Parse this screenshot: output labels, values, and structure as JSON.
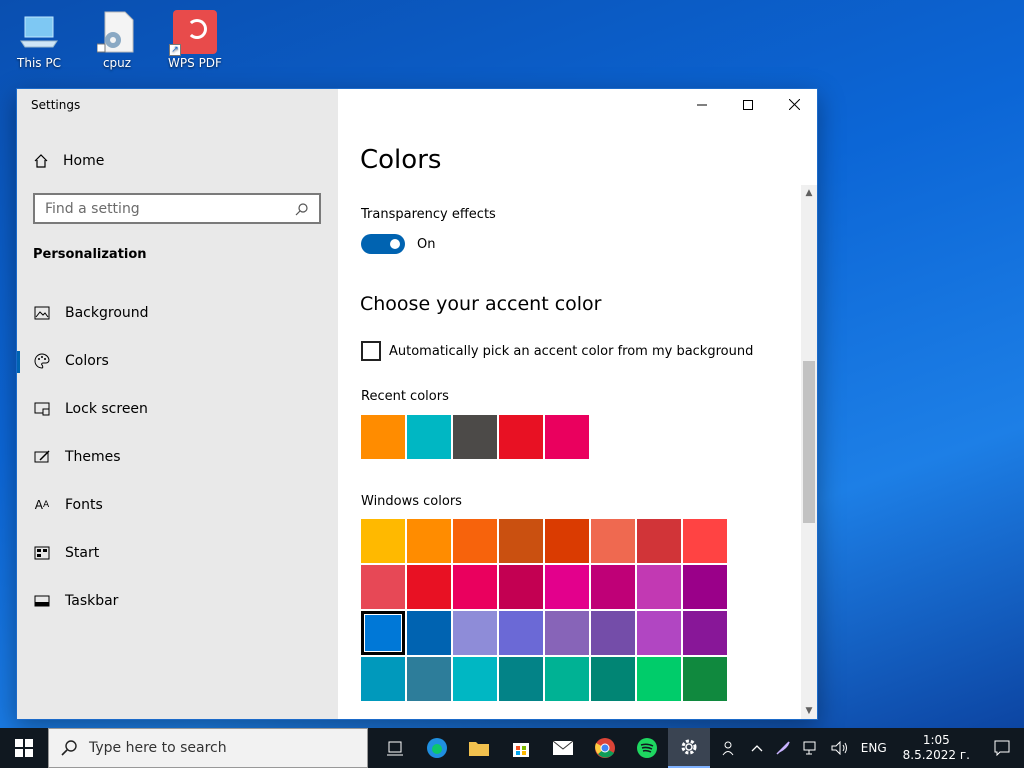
{
  "desktop": {
    "icons": [
      {
        "label": "This PC"
      },
      {
        "label": "cpuz"
      },
      {
        "label": "WPS PDF"
      }
    ]
  },
  "window": {
    "title": "Settings",
    "nav": {
      "home_label": "Home",
      "search_placeholder": "Find a setting",
      "section": "Personalization",
      "items": [
        {
          "label": "Background",
          "icon": "image-icon"
        },
        {
          "label": "Colors",
          "icon": "palette-icon"
        },
        {
          "label": "Lock screen",
          "icon": "lock-screen-icon"
        },
        {
          "label": "Themes",
          "icon": "themes-icon"
        },
        {
          "label": "Fonts",
          "icon": "fonts-icon"
        },
        {
          "label": "Start",
          "icon": "start-icon"
        },
        {
          "label": "Taskbar",
          "icon": "taskbar-icon"
        }
      ],
      "active_item": "Colors"
    },
    "main": {
      "title": "Colors",
      "transparency_label": "Transparency effects",
      "transparency_state": "On",
      "accent_heading": "Choose your accent color",
      "auto_pick_label": "Automatically pick an accent color from my background",
      "recent_label": "Recent colors",
      "recent_colors": [
        "#ff8c00",
        "#00b7c3",
        "#4c4a48",
        "#e81123",
        "#ea005e"
      ],
      "windows_label": "Windows colors",
      "windows_colors": [
        "#ffb900",
        "#ff8c00",
        "#f7630c",
        "#ca5010",
        "#da3b01",
        "#ef6950",
        "#d13438",
        "#ff4343",
        "#e74856",
        "#e81123",
        "#ea005e",
        "#c30052",
        "#e3008c",
        "#bf0077",
        "#c239b3",
        "#9a0089",
        "#0078d7",
        "#0063b1",
        "#8e8cd8",
        "#6b69d6",
        "#8764b8",
        "#744da9",
        "#b146c2",
        "#881798",
        "#0099bc",
        "#2d7d9a",
        "#00b7c3",
        "#038387",
        "#00b294",
        "#018574",
        "#00cc6a",
        "#10893e"
      ],
      "selected_color": "#0078d7"
    }
  },
  "taskbar": {
    "search_placeholder": "Type here to search",
    "language": "ENG",
    "time": "1:05",
    "date": "8.5.2022 г."
  },
  "colors": {
    "accent": "#0063b1",
    "taskbar_bg": "#101820"
  }
}
